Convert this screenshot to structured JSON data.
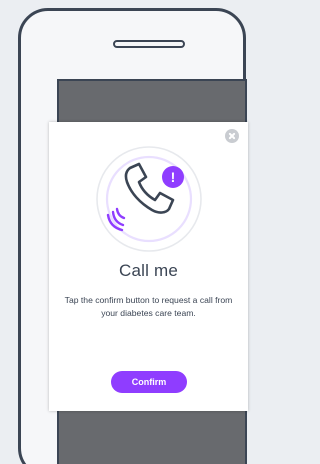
{
  "dialog": {
    "title": "Call me",
    "description": "Tap the confirm button to request a call from your diabetes care team.",
    "confirm_label": "Confirm",
    "badge_symbol": "!"
  },
  "icons": {
    "close": "close-icon",
    "phone": "phone-handset-icon",
    "alert": "exclamation-badge-icon"
  },
  "colors": {
    "background": "#ebeef2",
    "frame": "#3b4554",
    "overlay": "#686a6e",
    "accent": "#8f3dff",
    "text": "#3b4554"
  }
}
